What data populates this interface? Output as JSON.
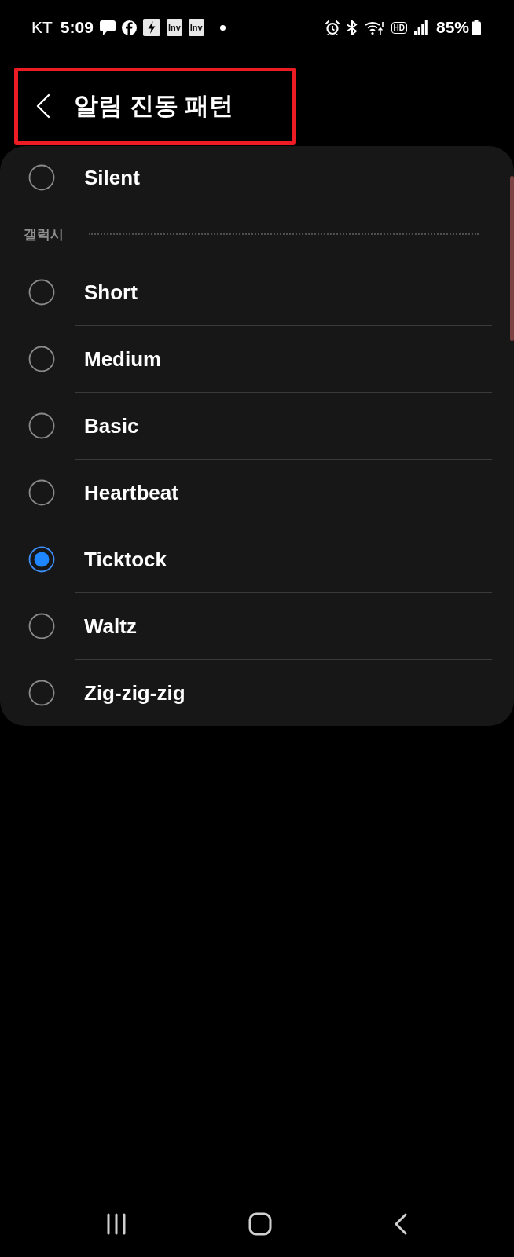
{
  "status_bar": {
    "carrier": "KT",
    "time": "5:09",
    "app_tiles": [
      "Inv",
      "Inv"
    ],
    "hd_label": "HD",
    "battery": "85%"
  },
  "header": {
    "title": "알림 진동 패턴",
    "highlighted": true
  },
  "list": {
    "items": [
      {
        "label": "Silent",
        "selected": false
      }
    ],
    "sections": [
      {
        "title": "갤럭시",
        "items": [
          {
            "label": "Short",
            "selected": false
          },
          {
            "label": "Medium",
            "selected": false
          },
          {
            "label": "Basic",
            "selected": false
          },
          {
            "label": "Heartbeat",
            "selected": false
          },
          {
            "label": "Ticktock",
            "selected": true
          },
          {
            "label": "Waltz",
            "selected": false
          },
          {
            "label": "Zig-zig-zig",
            "selected": false
          }
        ]
      }
    ]
  }
}
